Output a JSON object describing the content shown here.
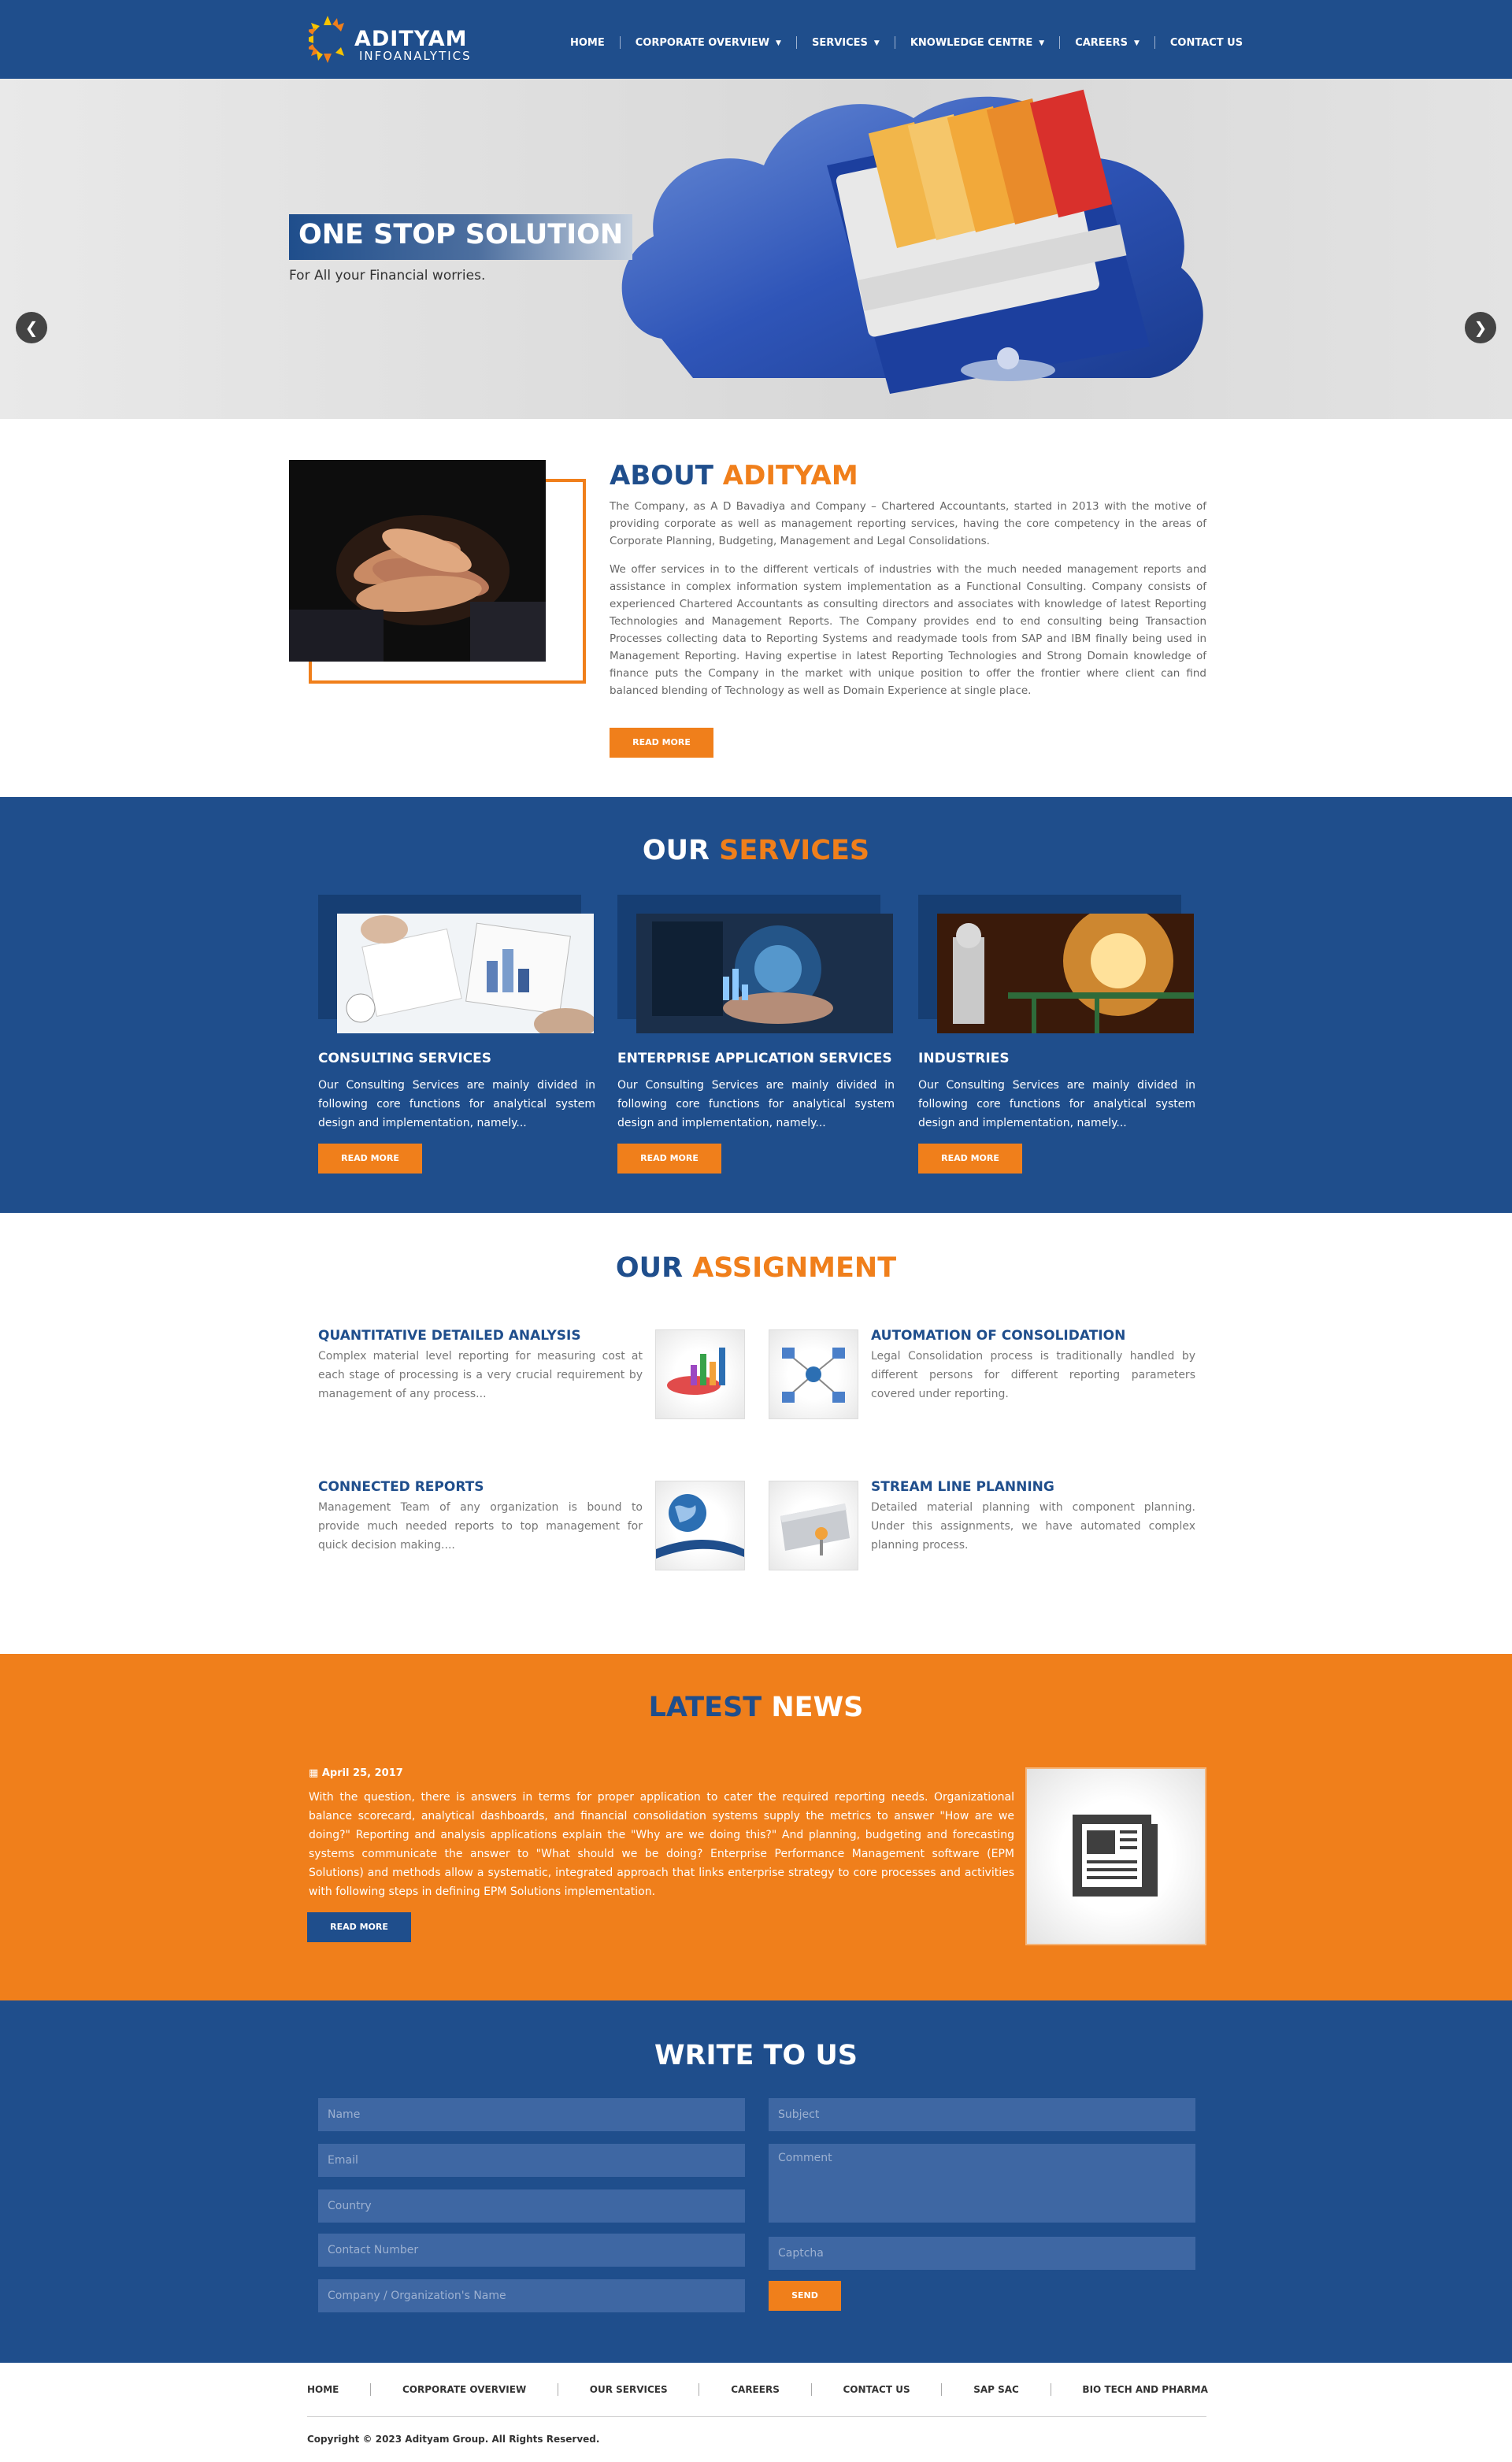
{
  "brand": {
    "name": "ADITYAM",
    "sub": "INFOANALYTICS"
  },
  "nav": {
    "home": "HOME",
    "corporate": "CORPORATE OVERVIEW",
    "services": "SERVICES",
    "knowledge": "KNOWLEDGE CENTRE",
    "careers": "CAREERS",
    "contact": "CONTACT US"
  },
  "hero": {
    "title": "ONE STOP SOLUTION",
    "subtitle": "For All your Financial worries.",
    "prev": "❮",
    "next": "❯"
  },
  "about": {
    "title_a": "ABOUT",
    "title_b": "ADITYAM",
    "p1": "The Company, as A D Bavadiya and Company – Chartered Accountants, started in 2013 with the motive of providing corporate as well as management reporting services, having the core competency in the areas of Corporate Planning, Budgeting, Management and Legal Consolidations.",
    "p2": "We offer services in to the different verticals of industries with the much needed management reports and assistance in complex information system implementation as a Functional Consulting. Company consists of experienced Chartered Accountants as consulting directors and associates with knowledge of latest Reporting Technologies and Management Reports. The Company provides end to end consulting being Transaction Processes collecting data to Reporting Systems and readymade tools from SAP and IBM finally being used in Management Reporting. Having expertise in latest Reporting Technologies and Strong Domain knowledge of finance puts the Company in the market with unique position to offer the frontier where client can find balanced blending of Technology as well as Domain Experience at single place.",
    "button": "READ MORE"
  },
  "services": {
    "title_a": "OUR",
    "title_b": "SERVICES",
    "items": [
      {
        "name": "CONSULTING SERVICES",
        "desc": "Our Consulting Services are mainly divided in following core functions for analytical system design and implementation, namely...",
        "button": "READ MORE"
      },
      {
        "name": "ENTERPRISE APPLICATION SERVICES",
        "desc": "Our Consulting Services are mainly divided in following core functions for analytical system design and implementation, namely...",
        "button": "READ MORE"
      },
      {
        "name": "INDUSTRIES",
        "desc": "Our Consulting Services are mainly divided in following core functions for analytical system design and implementation, namely...",
        "button": "READ MORE"
      }
    ]
  },
  "assignment": {
    "title_a": "OUR",
    "title_b": "ASSIGNMENT",
    "items": [
      {
        "title": "QUANTITATIVE DETAILED ANALYSIS",
        "desc": "Complex material level reporting for measuring cost at each stage of processing is a very crucial requirement by management of any process..."
      },
      {
        "title": "AUTOMATION OF CONSOLIDATION",
        "desc": "Legal Consolidation process is traditionally handled by different persons for different reporting parameters covered under reporting."
      },
      {
        "title": "CONNECTED REPORTS",
        "desc": "Management Team of any organization is bound to provide much needed reports to top management for quick decision making...."
      },
      {
        "title": "STREAM LINE PLANNING",
        "desc": "Detailed material planning with component planning. Under this assignments, we have automated complex planning process."
      }
    ]
  },
  "news": {
    "title_a": "LATEST",
    "title_b": "NEWS",
    "date": "April 25, 2017",
    "text": "With the question, there is answers in terms for proper application to cater the required reporting needs. Organizational balance scorecard, analytical dashboards, and financial consolidation systems supply the metrics to answer \"How are we doing?\" Reporting and analysis applications explain the \"Why are we doing this?\" And planning, budgeting and forecasting systems communicate the answer to \"What should we be doing? Enterprise Performance Management software (EPM Solutions) and methods allow a systematic, integrated approach that links enterprise strategy to core processes and activities with following steps in defining EPM Solutions implementation.",
    "button": "READ MORE"
  },
  "contact": {
    "title": "WRITE TO US",
    "name": "Name",
    "email": "Email",
    "country": "Country",
    "phone": "Contact Number",
    "company": "Company / Organization's Name",
    "subject": "Subject",
    "comment": "Comment",
    "captcha": "Captcha",
    "send": "SEND"
  },
  "footer": {
    "links": [
      "HOME",
      "CORPORATE OVERVIEW",
      "OUR SERVICES",
      "CAREERS",
      "CONTACT US",
      "SAP SAC",
      "BIO TECH AND PHARMA"
    ],
    "copyright": "Copyright © 2023 Adityam Group. All Rights Reserved."
  }
}
